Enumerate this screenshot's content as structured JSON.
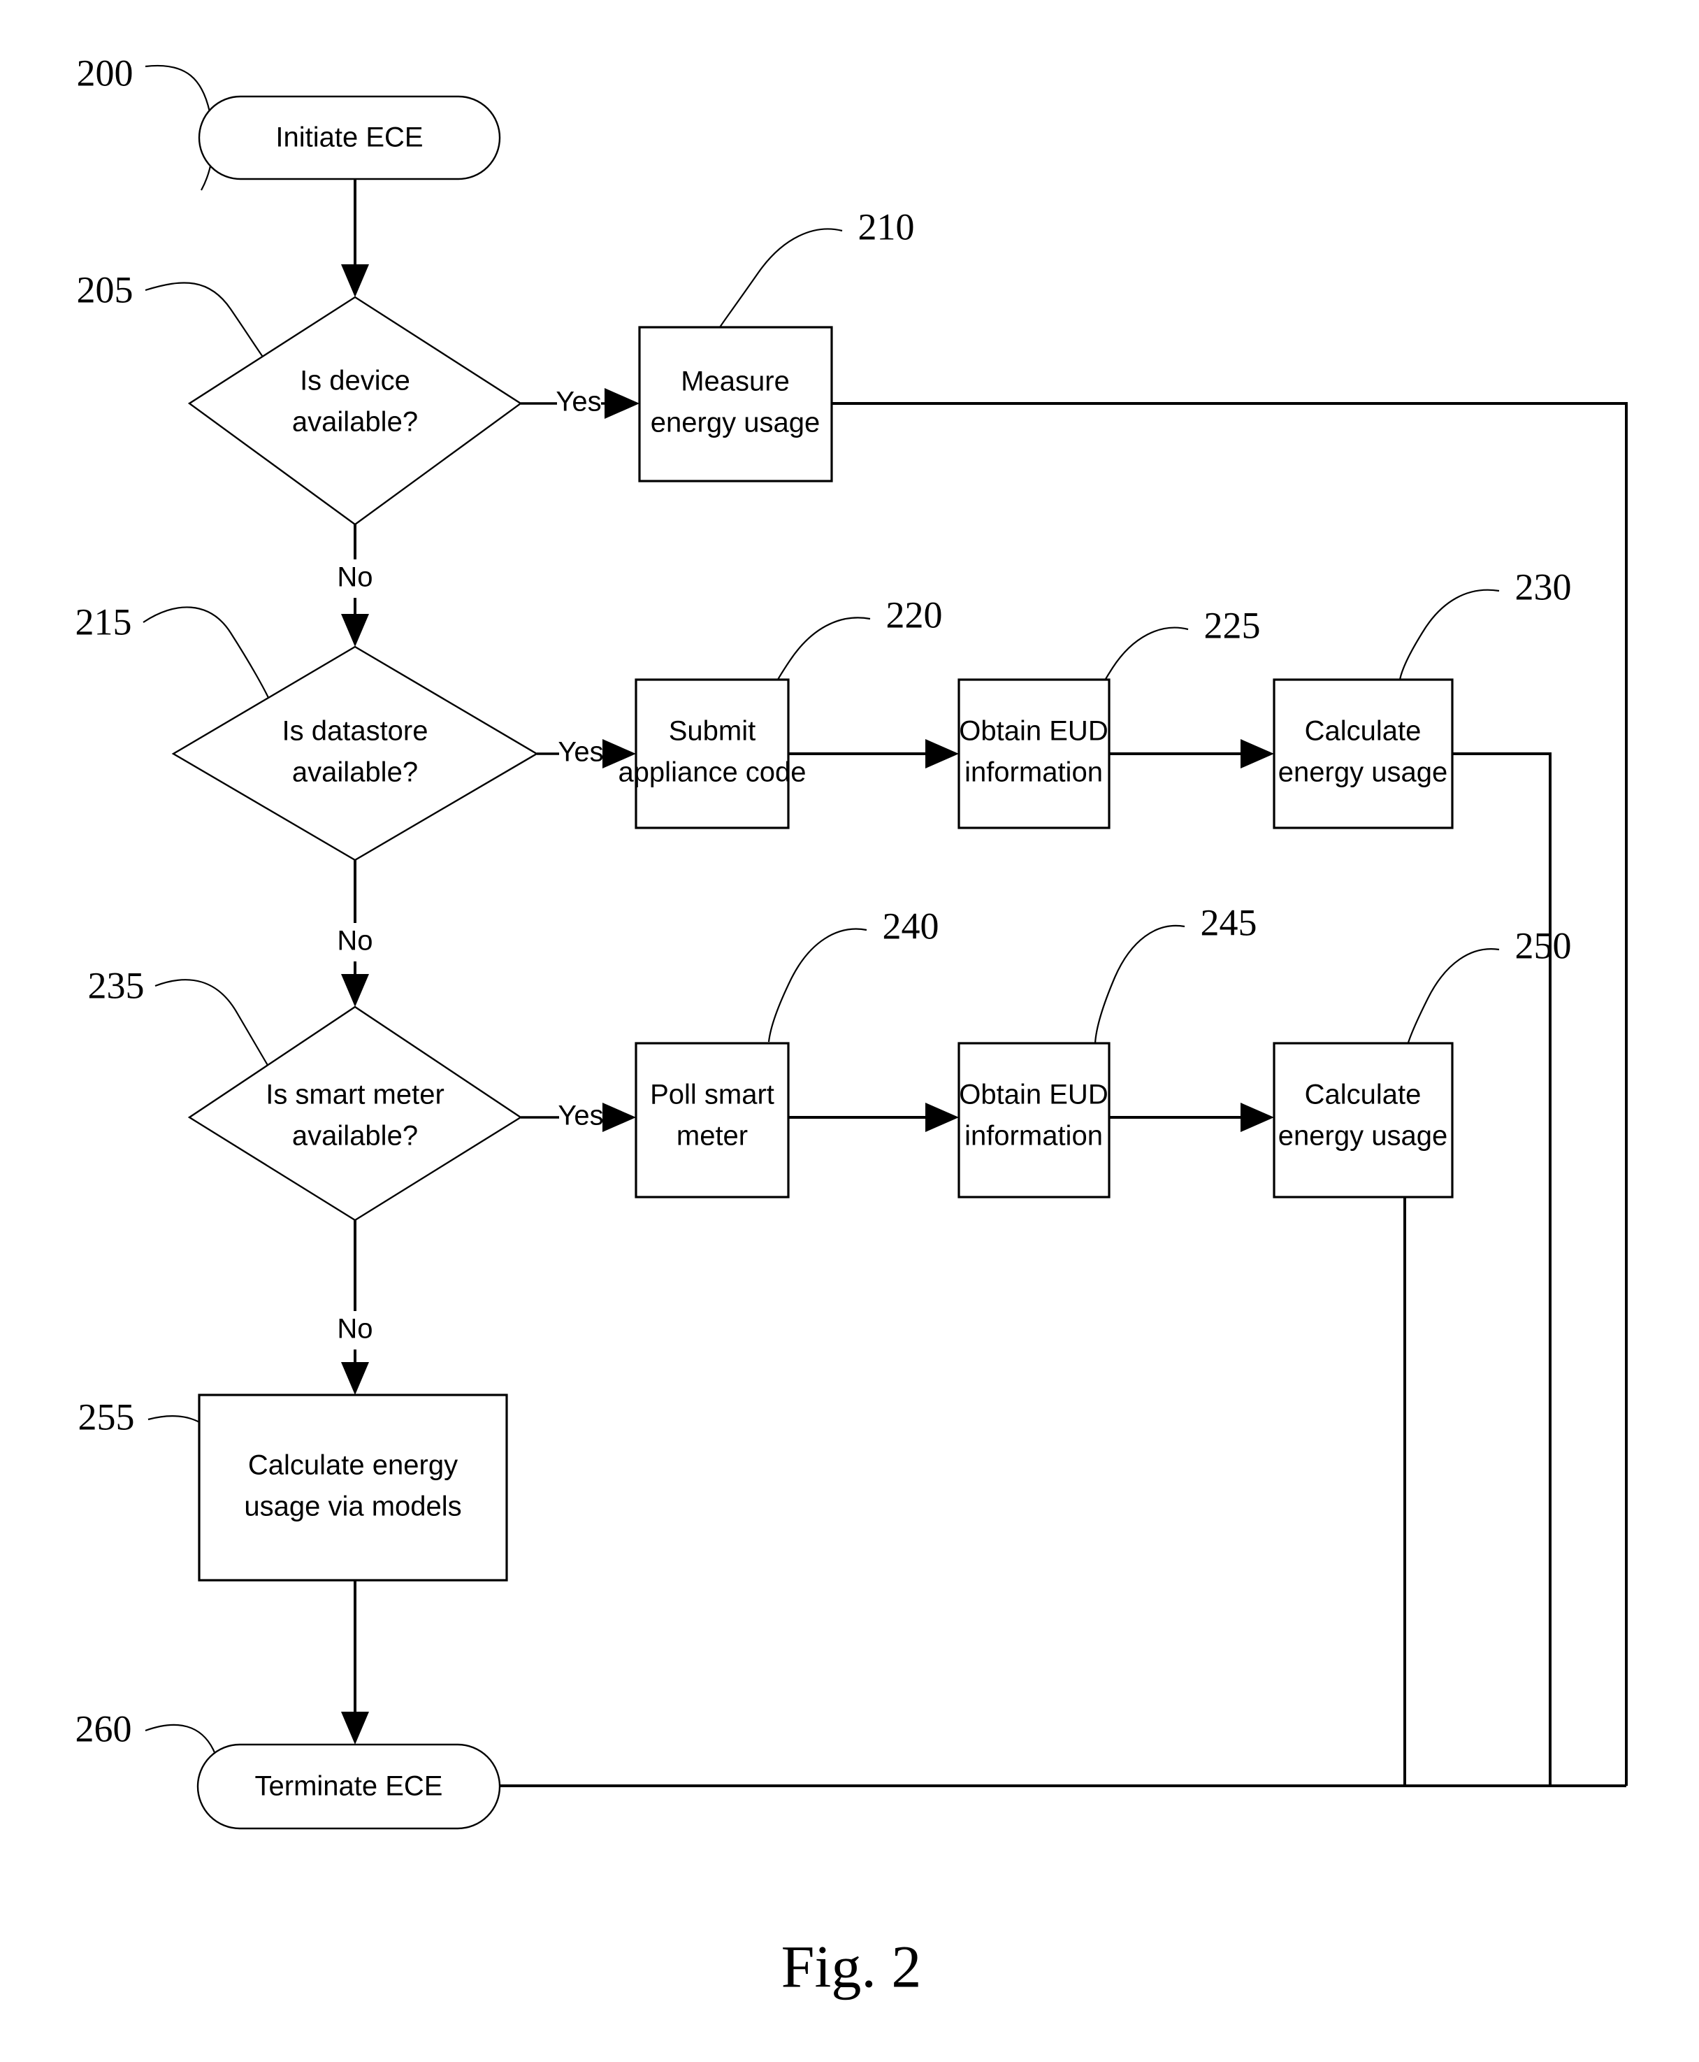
{
  "figure": {
    "caption": "Fig. 2",
    "nodes": {
      "start": {
        "ref": "200",
        "label": "Initiate ECE",
        "shape": "terminator"
      },
      "decision_device": {
        "ref": "205",
        "line1": "Is device",
        "line2": "available?",
        "shape": "decision"
      },
      "measure": {
        "ref": "210",
        "line1": "Measure",
        "line2": "energy usage",
        "shape": "process"
      },
      "decision_datastore": {
        "ref": "215",
        "line1": "Is datastore",
        "line2": "available?",
        "shape": "decision"
      },
      "submit_code": {
        "ref": "220",
        "line1": "Submit",
        "line2": "appliance code",
        "shape": "process"
      },
      "obtain_eud_ds": {
        "ref": "225",
        "line1": "Obtain EUD",
        "line2": "information",
        "shape": "process"
      },
      "calc_usage_ds": {
        "ref": "230",
        "line1": "Calculate",
        "line2": "energy usage",
        "shape": "process"
      },
      "decision_smartmeter": {
        "ref": "235",
        "line1": "Is smart meter",
        "line2": "available?",
        "shape": "decision"
      },
      "poll_meter": {
        "ref": "240",
        "line1": "Poll smart",
        "line2": "meter",
        "shape": "process"
      },
      "obtain_eud_sm": {
        "ref": "245",
        "line1": "Obtain EUD",
        "line2": "information",
        "shape": "process"
      },
      "calc_usage_sm": {
        "ref": "250",
        "line1": "Calculate",
        "line2": "energy usage",
        "shape": "process"
      },
      "calc_models": {
        "ref": "255",
        "line1": "Calculate energy",
        "line2": "usage via models",
        "shape": "process"
      },
      "end": {
        "ref": "260",
        "label": "Terminate ECE",
        "shape": "terminator"
      }
    },
    "edge_labels": {
      "yes_device": "Yes",
      "no_device": "No",
      "yes_datastore": "Yes",
      "no_datastore": "No",
      "yes_smartmeter": "Yes",
      "no_smartmeter": "No"
    },
    "colors": {
      "stroke": "#000000",
      "fill": "#ffffff",
      "background": "#ffffff"
    }
  }
}
